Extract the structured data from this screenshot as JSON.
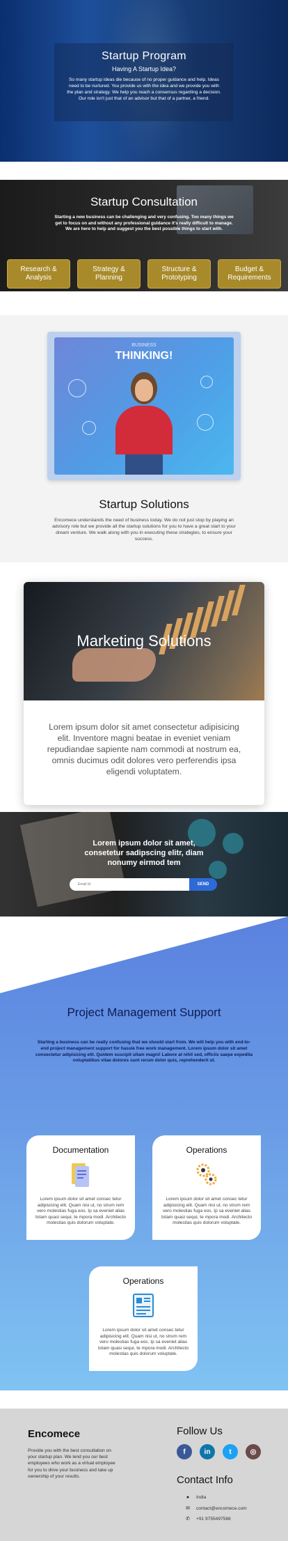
{
  "hero": {
    "title": "Startup Program",
    "subtitle": "Having A Startup Idea?",
    "text": "So many startup ideas die because of no proper guidance and help. Ideas need to be nurtured. You provide us with the idea and we provide you with the plan and strategy. We help you reach a consensus regarding a decision. Our role isn't just that of an advisor but that of a partner, a friend."
  },
  "consultation": {
    "title": "Startup Consultation",
    "text": "Starting a new business can be challenging and very confusing. Too many things we get to focus on and without any professional guidance it's really difficult to manage. We are here to help and suggest you the best possible things to start with.",
    "buttons": [
      "Research & Analysis",
      "Strategy & Planning",
      "Structure & Prototyping",
      "Budget & Requirements"
    ]
  },
  "solutions": {
    "image_top_text": "BUSINESS",
    "image_title": "THINKING!",
    "title": "Startup Solutions",
    "text": "Encomece understands the need of business today. We do not just stop by playing an advisory role but we provide all the startup solutions for you to have a great start to your dream venture. We walk along with you in executing these strategies, to ensure your success."
  },
  "marketing": {
    "title": "Marketing Solutions",
    "text": "Lorem ipsum dolor sit amet consectetur adipisicing elit. Inventore magni beatae in eveniet veniam repudiandae sapiente nam commodi at nostrum ea, omnis ducimus odit dolores vero perferendis ipsa eligendi voluptatem."
  },
  "newsletter": {
    "heading": "Lorem ipsum dolor sit amet, consetetur sadipscing elitr, diam nonumy eirmod tem",
    "placeholder": "Email Id",
    "button": "SEND"
  },
  "project": {
    "title": "Project Management Support",
    "text": "Starting a business can be really confusing that we should start from. We will help you with end-to-end project management support for hassle free work management. Lorem ipsum dolor sit amet consectetur adipisicing elit. Quidem suscipit ullam magni! Labore at nihil sed, officiis saepe expedita voluptatibus vitae dolores sunt rerum dolor quis, reprehenderit ut.",
    "cards": [
      {
        "title": "Documentation",
        "icon": "documents-icon",
        "text": "Lorem ipsum dolor sit amet consec tetur adipisicing elit. Quam nisi ut, no strum rem vero molestias fuga eos. Ip sa eveniet alias totam quasi sequi, te mpora modi. Architecto molestias quis dolorum voluptate."
      },
      {
        "title": "Operations",
        "icon": "gears-icon",
        "text": "Lorem ipsum dolor sit amet consec tetur adipisicing elit. Quam nisi ut, no strum rem vero molestias fuga eos. Ip sa eveniet alias totam quasi sequi, te mpora modi. Architecto molestias quis dolorum voluptate."
      },
      {
        "title": "Operations",
        "icon": "dashboard-icon",
        "text": "Lorem ipsum dolor sit amet consec tetur adipisicing elit. Quam nisi ut, no strum rem vero molestias fuga eos. Ip sa eveniet alias totam quasi sequi, te mpora modi. Architecto molestias quis dolorum voluptate."
      }
    ]
  },
  "footer": {
    "brand": "Encomece",
    "about": "Provide you with the best consultation on your startup plan. We lend you our best employees who work as a virtual employee for you to drive your business and take up ownership of your results.",
    "follow_title": "Follow Us",
    "socials": [
      {
        "name": "facebook-icon",
        "glyph": "f",
        "color": "#3b5998"
      },
      {
        "name": "linkedin-icon",
        "glyph": "in",
        "color": "#0e76a8"
      },
      {
        "name": "twitter-icon",
        "glyph": "t",
        "color": "#1da1f2"
      },
      {
        "name": "instagram-icon",
        "glyph": "◎",
        "color": "#8a3ab9"
      }
    ],
    "contact_title": "Contact Info",
    "contacts": [
      {
        "icon": "location-icon",
        "glyph": "●",
        "text": "India"
      },
      {
        "icon": "mail-icon",
        "glyph": "✉",
        "text": "contact@encomece.com"
      },
      {
        "icon": "phone-icon",
        "glyph": "✆",
        "text": "+91 9755497568"
      }
    ]
  },
  "colors": {
    "gold_button": "#a88a2a",
    "send_button": "#2d6ad8",
    "pm_top": "#5a82df",
    "pm_bottom": "#80c3f2",
    "pm_heading": "#0d1b52"
  }
}
